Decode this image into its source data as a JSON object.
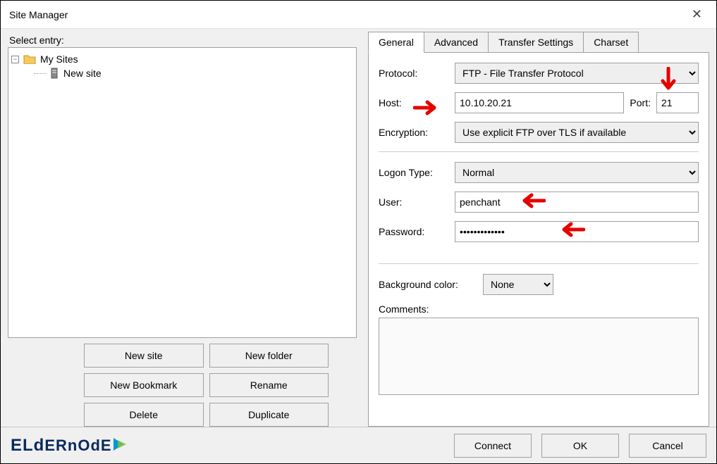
{
  "window": {
    "title": "Site Manager"
  },
  "left": {
    "select_label": "Select entry:",
    "tree": {
      "root": {
        "label": "My Sites"
      },
      "child": {
        "label": "New site"
      }
    },
    "buttons": {
      "new_site": "New site",
      "new_folder": "New folder",
      "new_bookmark": "New Bookmark",
      "rename": "Rename",
      "delete": "Delete",
      "duplicate": "Duplicate"
    }
  },
  "tabs": {
    "general": "General",
    "advanced": "Advanced",
    "transfer": "Transfer Settings",
    "charset": "Charset"
  },
  "form": {
    "protocol_label": "Protocol:",
    "protocol_value": "FTP - File Transfer Protocol",
    "host_label": "Host:",
    "host_value": "10.10.20.21",
    "port_label": "Port:",
    "port_value": "21",
    "encryption_label": "Encryption:",
    "encryption_value": "Use explicit FTP over TLS if available",
    "logon_label": "Logon Type:",
    "logon_value": "Normal",
    "user_label": "User:",
    "user_value": "penchant",
    "password_label": "Password:",
    "password_value": "•••••••••••••",
    "bgcolor_label": "Background color:",
    "bgcolor_value": "None",
    "comments_label": "Comments:"
  },
  "bottom": {
    "connect": "Connect",
    "ok": "OK",
    "cancel": "Cancel"
  },
  "logo": {
    "text1": "ELd",
    "text2": "ERnOd",
    "text3": "E"
  }
}
